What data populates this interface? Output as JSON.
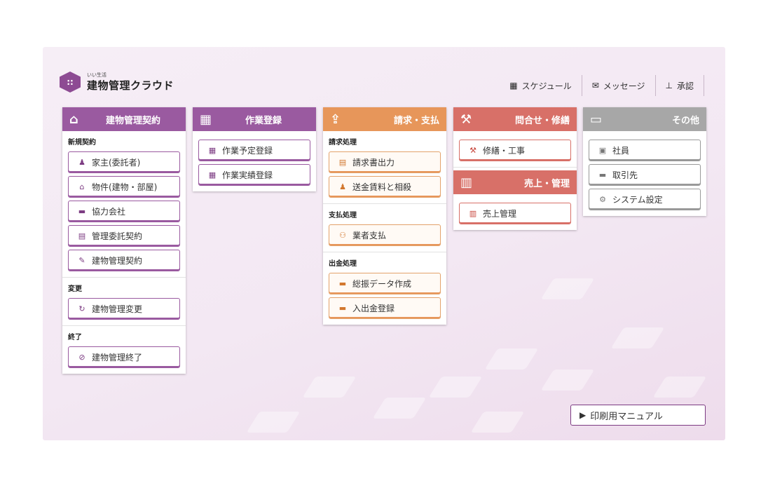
{
  "logo": {
    "small": "いい生活",
    "title": "建物管理クラウド",
    "mark": "::"
  },
  "nav": [
    {
      "icon": "▦",
      "label": "スケジュール"
    },
    {
      "icon": "✉",
      "label": "メッセージ"
    },
    {
      "icon": "⊥",
      "label": "承認"
    }
  ],
  "columns": {
    "contract": {
      "title": "建物管理契約",
      "icon": "⌂",
      "sections": [
        {
          "label": "新規契約",
          "items": [
            {
              "icon": "♟",
              "label": "家主(委託者)"
            },
            {
              "icon": "⌂",
              "label": "物件(建物・部屋)"
            },
            {
              "icon": "▬",
              "label": "協力会社"
            },
            {
              "icon": "▤",
              "label": "管理委託契約"
            },
            {
              "icon": "✎",
              "label": "建物管理契約"
            }
          ]
        },
        {
          "label": "変更",
          "items": [
            {
              "icon": "↻",
              "label": "建物管理変更"
            }
          ]
        },
        {
          "label": "終了",
          "items": [
            {
              "icon": "⊘",
              "label": "建物管理終了"
            }
          ]
        }
      ]
    },
    "work": {
      "title": "作業登録",
      "icon": "▦",
      "items": [
        {
          "icon": "▦",
          "label": "作業予定登録"
        },
        {
          "icon": "▦",
          "label": "作業実績登録"
        }
      ]
    },
    "billing": {
      "title": "請求・支払",
      "icon": "⇪",
      "sections": [
        {
          "label": "請求処理",
          "items": [
            {
              "icon": "▤",
              "label": "請求書出力"
            },
            {
              "icon": "♟",
              "label": "送金賃料と相殺"
            }
          ]
        },
        {
          "label": "支払処理",
          "items": [
            {
              "icon": "⚇",
              "label": "業者支払"
            }
          ]
        },
        {
          "label": "出金処理",
          "items": [
            {
              "icon": "▬",
              "label": "総振データ作成"
            },
            {
              "icon": "▬",
              "label": "入出金登録"
            }
          ]
        }
      ]
    },
    "inquiry": {
      "title": "問合せ・修繕",
      "icon": "⚒",
      "items": [
        {
          "icon": "⚒",
          "label": "修繕・工事"
        }
      ]
    },
    "sales": {
      "title": "売上・管理",
      "icon": "▥",
      "items": [
        {
          "icon": "▥",
          "label": "売上管理"
        }
      ]
    },
    "other": {
      "title": "その他",
      "icon": "▭",
      "items": [
        {
          "icon": "▣",
          "label": "社員"
        },
        {
          "icon": "▬",
          "label": "取引先"
        },
        {
          "icon": "⚙",
          "label": "システム設定"
        }
      ]
    }
  },
  "manual": {
    "icon": "▶",
    "label": "印刷用マニュアル"
  }
}
